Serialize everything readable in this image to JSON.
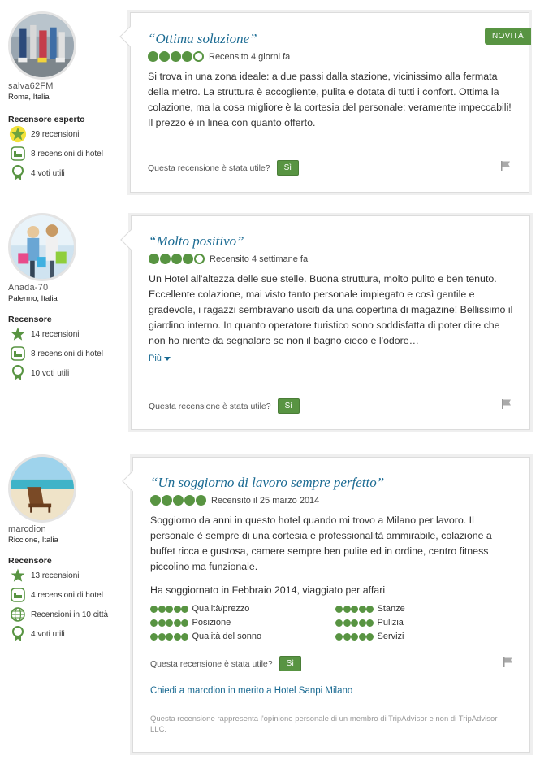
{
  "reviews": [
    {
      "user": {
        "name": "salva62FM",
        "location": "Roma, Italia",
        "level": "Recensore esperto",
        "badges": [
          {
            "icon": "star-icon",
            "text": "29 recensioni"
          },
          {
            "icon": "hotel-bed-icon",
            "text": "8 recensioni di hotel"
          },
          {
            "icon": "ribbon-icon",
            "text": "4 voti utili"
          }
        ]
      },
      "badge_new": "NOVITÀ",
      "title": "“Ottima soluzione”",
      "rating": 4,
      "date": "Recensito 4 giorni fa",
      "text": "Si trova in una zona ideale: a due passi dalla stazione, vicinissimo alla fermata della metro. La struttura è accogliente, pulita e dotata di tutti i confort. Ottima la colazione, ma la cosa migliore è la cortesia del personale: veramente impeccabili! Il prezzo è in linea con quanto offerto.",
      "helpful_q": "Questa recensione è stata utile?",
      "helpful_btn": "Sì"
    },
    {
      "user": {
        "name": "Anada-70",
        "location": "Palermo, Italia",
        "level": "Recensore",
        "badges": [
          {
            "icon": "star-icon",
            "text": "14 recensioni"
          },
          {
            "icon": "hotel-bed-icon",
            "text": "8 recensioni di hotel"
          },
          {
            "icon": "ribbon-icon",
            "text": "10 voti utili"
          }
        ]
      },
      "title": "“Molto positivo”",
      "rating": 4,
      "date": "Recensito 4 settimane fa",
      "text": "Un Hotel all'altezza delle sue stelle. Buona struttura, molto pulito e ben tenuto. Eccellente colazione, mai visto tanto personale impiegato e così gentile e gradevole, i ragazzi sembravano usciti da una copertina di magazine! Bellissimo il giardino interno. In quanto operatore turistico sono soddisfatta di poter dire che non ho niente da segnalare se non il bagno cieco e l'odore…",
      "more": "Più",
      "helpful_q": "Questa recensione è stata utile?",
      "helpful_btn": "Sì"
    },
    {
      "user": {
        "name": "marcdion",
        "location": "Riccione, Italia",
        "level": "Recensore",
        "badges": [
          {
            "icon": "star-icon",
            "text": "13 recensioni"
          },
          {
            "icon": "hotel-bed-icon",
            "text": "4 recensioni di hotel"
          },
          {
            "icon": "globe-icon",
            "text": "Recensioni in 10 città"
          },
          {
            "icon": "ribbon-icon",
            "text": "4 voti utili"
          }
        ]
      },
      "title": "“Un soggiorno di lavoro sempre perfetto”",
      "rating": 5,
      "date": "Recensito il 25 marzo 2014",
      "text": "Soggiorno da anni in questo hotel quando mi trovo a Milano per lavoro. Il personale è sempre di una cortesia e professionalità ammirabile, colazione a buffet ricca e gustosa, camere sempre ben pulite ed in ordine, centro fitness piccolino ma funzionale.",
      "stayed": "Ha soggiornato in Febbraio 2014, viaggiato per affari",
      "sub_ratings": [
        "Qualità/prezzo",
        "Stanze",
        "Posizione",
        "Pulizia",
        "Qualità del sonno",
        "Servizi"
      ],
      "helpful_q": "Questa recensione è stata utile?",
      "helpful_btn": "Sì",
      "ask": "Chiedi a marcdion in merito a Hotel Sanpi Milano",
      "disclaimer": "Questa recensione rappresenta l'opinione personale di un membro di TripAdvisor e non di TripAdvisor LLC."
    }
  ]
}
